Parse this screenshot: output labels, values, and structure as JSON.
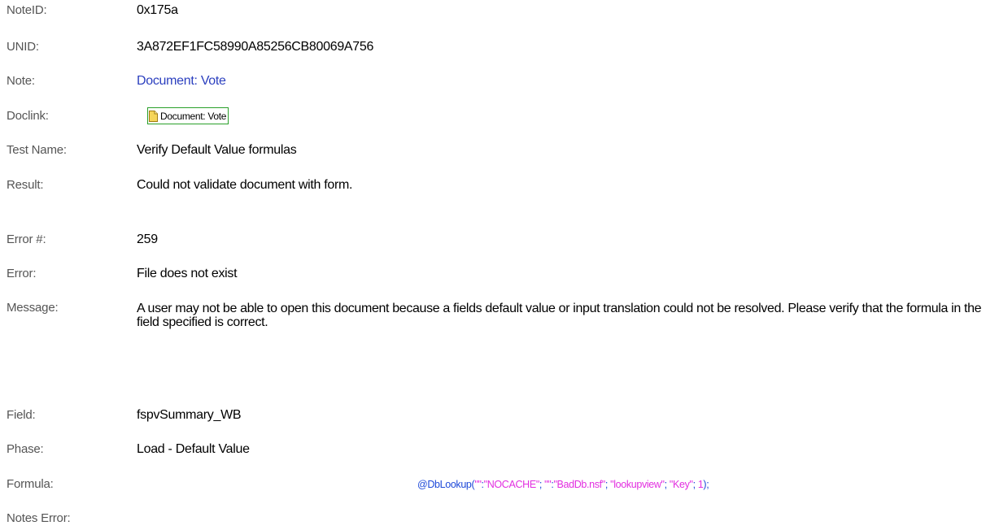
{
  "fields": {
    "noteid": {
      "label": "NoteID:",
      "value": "0x175a"
    },
    "unid": {
      "label": "UNID:",
      "value": "3A872EF1FC58990A85256CB80069A756"
    },
    "note": {
      "label": "Note:",
      "value": "Document: Vote"
    },
    "doclink": {
      "label": "Doclink:",
      "value": "Document: Vote"
    },
    "test_name": {
      "label": "Test Name:",
      "value": "Verify Default Value formulas"
    },
    "result": {
      "label": "Result:",
      "value": "Could not validate document with form."
    },
    "error_num": {
      "label": "Error #:",
      "value": "259"
    },
    "error": {
      "label": "Error:",
      "value": "File does not exist"
    },
    "message": {
      "label": "Message:",
      "value": "A user may not be able to open this document because a fields default value or input translation could not be resolved. Please verify that the formula in the field specified is correct."
    },
    "field": {
      "label": "Field:",
      "value": "fspvSummary_WB"
    },
    "phase": {
      "label": "Phase:",
      "value": "Load - Default Value"
    },
    "formula": {
      "label": "Formula:"
    },
    "notes_error": {
      "label": "Notes Error:"
    }
  },
  "formula": {
    "fn": "@DbLookup",
    "open": "(",
    "arg1a": "\"\"",
    "colon1": ":",
    "arg1b": "\"NOCACHE\"",
    "sep1": "; ",
    "arg2a": "\"\"",
    "colon2": ":",
    "arg2b": "\"BadDb.nsf\"",
    "sep2": "; ",
    "arg3": "\"lookupview\"",
    "sep3": "; ",
    "arg4": "\"Key\"",
    "sep4": "; ",
    "arg5": "1",
    "close": ");"
  },
  "colors": {
    "label": "#555555",
    "link": "#2b3fbf",
    "doclink_border": "#2aa02a",
    "formula_function": "#1f4ad9",
    "formula_string": "#e22fe0"
  },
  "icons": {
    "doclink": "document-icon"
  }
}
